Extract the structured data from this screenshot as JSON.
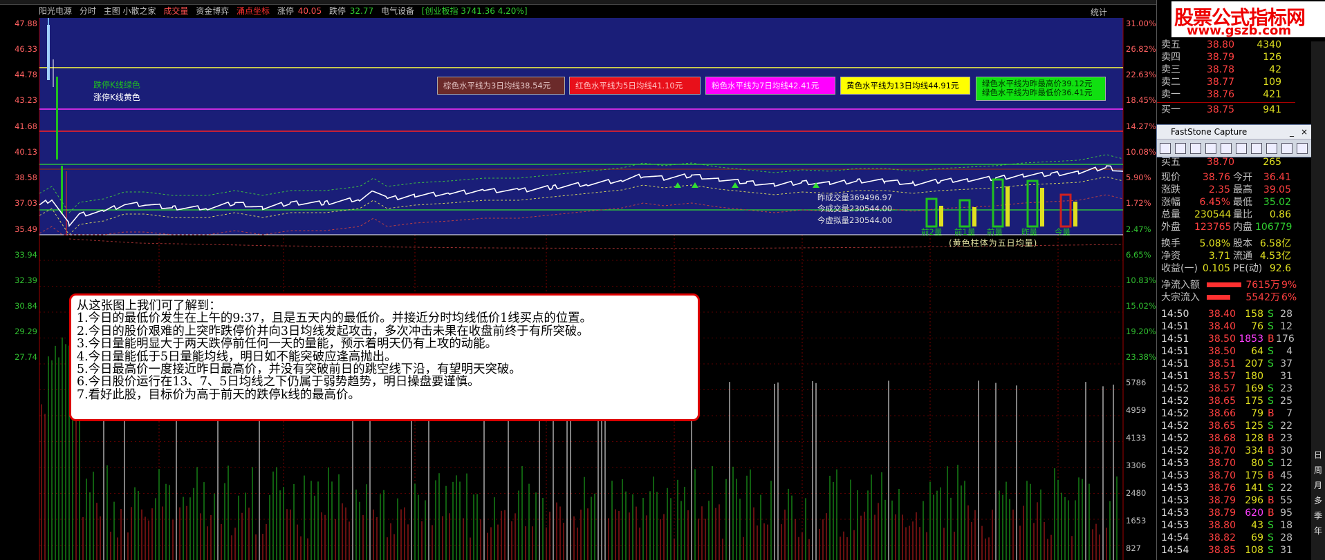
{
  "infobar": {
    "stock": "阳光电源",
    "tab_fen": "分时",
    "tab_main": "主图 小散之家",
    "deal": "成交量",
    "fund": "资金博弈",
    "hot": "涌点坐标",
    "up_label": "涨停",
    "up_value": "40.05",
    "down_label": "跌停",
    "down_value": "32.77",
    "sector": "电气设备",
    "index": "[创业板指 3741.36 4.20%]",
    "stats": "统计"
  },
  "price_labels": [
    "47.88",
    "46.33",
    "44.78",
    "43.23",
    "41.68",
    "40.13",
    "38.58",
    "37.03",
    "35.49",
    "33.94",
    "32.39",
    "30.84",
    "29.29",
    "27.74"
  ],
  "pct_labels": [
    "31.00%",
    "26.82%",
    "22.63%",
    "18.45%",
    "14.27%",
    "10.08%",
    "5.90%",
    "1.72%",
    "2.47%",
    "6.65%",
    "10.83%",
    "15.02%",
    "19.20%",
    "23.38%"
  ],
  "vol_labels": [
    "5786",
    "4959",
    "4133",
    "3306",
    "2480",
    "1653",
    "827"
  ],
  "overlay_labels": {
    "limit_down_green": "跌停K线绿色",
    "limit_up_yellow": "涨停K线黄色"
  },
  "legends": [
    {
      "text": "棕色水平线为3日均线38.54元",
      "bg": "#6b2a2a",
      "fg": "#e0c0c0"
    },
    {
      "text": "红色水平线为5日均线41.10元",
      "bg": "#e8101a",
      "fg": "#ffc0c0"
    },
    {
      "text": "粉色水平线为7日均线42.41元",
      "bg": "#ff00ff",
      "fg": "#ffe0ff"
    },
    {
      "text": "黄色水平线为13日均线44.91元",
      "bg": "#ffff00",
      "fg": "#000000"
    },
    {
      "text": "绿色水平线为昨最高价39.12元",
      "text2": "绿色水平线为昨最低价36.41元",
      "bg": "#10e010",
      "fg": "#003000"
    }
  ],
  "volume_info": {
    "yesterday": "昨成交量369496.97",
    "today": "今成交量230544.00",
    "virtual": "今虚拟量230544.00"
  },
  "bar_labels": [
    "前2量",
    "前1量",
    "前量",
    "昨量",
    "今量"
  ],
  "bar_note": "(黄色柱体为五日均量)",
  "note": {
    "lines": [
      "从这张图上我们可了解到：",
      "1.今日的最低价发生在上午的9:37，且是五天内的最低价。并接近分时均线低价1线买点的位置。",
      "2.今日的股价艰难的上突昨跌停价并向3日均线发起攻击，多次冲击未果在收盘前终于有所突破。",
      "3.今日量能明显大于两天跌停前任何一天的量能，预示着明天仍有上攻的动能。",
      "4.今日量能低于5日量能均线，明日如不能突破应逢高抛出。",
      "5.今日最高价一度接近昨日最高价，并没有突破前日的跳空线下沿，有望明天突破。",
      "6.今日股价运行在13、7、5日均线之下仍属于弱势趋势，明日操盘要谨慎。",
      "7.看好此股，目标价为高于前天的跌停k线的最高价。"
    ]
  },
  "watermark": {
    "cn": "股票公式指标网",
    "url": "www.gszb.com"
  },
  "order_book": [
    {
      "label": "卖五",
      "price": "38.80",
      "vol": "4340"
    },
    {
      "label": "卖四",
      "price": "38.79",
      "vol": "126"
    },
    {
      "label": "卖三",
      "price": "38.78",
      "vol": "42"
    },
    {
      "label": "卖二",
      "price": "38.77",
      "vol": "109"
    },
    {
      "label": "卖一",
      "price": "38.76",
      "vol": "421"
    },
    {
      "label": "买一",
      "price": "38.75",
      "vol": "941"
    },
    {
      "label": "买五",
      "price": "38.70",
      "vol": "265"
    }
  ],
  "faststone": {
    "title": "FastStone Capture",
    "min": "_",
    "close": "×"
  },
  "quote": [
    {
      "l1": "现价",
      "v1": "38.76",
      "l2": "今开",
      "v2": "36.41"
    },
    {
      "l1": "涨跌",
      "v1": "2.35",
      "l2": "最高",
      "v2": "39.05"
    },
    {
      "l1": "涨幅",
      "v1": "6.45%",
      "l2": "最低",
      "v2": "35.02"
    },
    {
      "l1": "总量",
      "v1": "230544",
      "l2": "量比",
      "v2": "0.86"
    },
    {
      "l1": "外盘",
      "v1": "123765",
      "l2": "内盘",
      "v2": "106779"
    },
    {
      "l1": "换手",
      "v1": "5.08%",
      "l2": "股本",
      "v2": "6.58亿"
    },
    {
      "l1": "净资",
      "v1": "3.71",
      "l2": "流通",
      "v2": "4.53亿"
    },
    {
      "l1": "收益(一)",
      "v1": "0.105",
      "l2": "PE(动)",
      "v2": "92.6"
    }
  ],
  "flow": [
    {
      "label": "净流入额",
      "value": "7615万",
      "pct": "9%"
    },
    {
      "label": "大宗流入",
      "value": "5542万",
      "pct": "6%"
    }
  ],
  "ticks": [
    {
      "t": "14:50",
      "p": "38.40",
      "v": "158",
      "s": "S",
      "n": "28"
    },
    {
      "t": "14:51",
      "p": "38.40",
      "v": "76",
      "s": "S",
      "n": "12"
    },
    {
      "t": "14:51",
      "p": "38.50",
      "v": "1853",
      "s": "B",
      "n": "176"
    },
    {
      "t": "14:51",
      "p": "38.50",
      "v": "64",
      "s": "S",
      "n": "4"
    },
    {
      "t": "14:51",
      "p": "38.51",
      "v": "207",
      "s": "S",
      "n": "37"
    },
    {
      "t": "14:51",
      "p": "38.57",
      "v": "180",
      "s": "",
      "n": "31"
    },
    {
      "t": "14:52",
      "p": "38.57",
      "v": "169",
      "s": "S",
      "n": "23"
    },
    {
      "t": "14:52",
      "p": "38.65",
      "v": "175",
      "s": "S",
      "n": "25"
    },
    {
      "t": "14:52",
      "p": "38.66",
      "v": "79",
      "s": "B",
      "n": "7"
    },
    {
      "t": "14:52",
      "p": "38.65",
      "v": "125",
      "s": "S",
      "n": "22"
    },
    {
      "t": "14:52",
      "p": "38.68",
      "v": "128",
      "s": "B",
      "n": "23"
    },
    {
      "t": "14:52",
      "p": "38.70",
      "v": "334",
      "s": "B",
      "n": "30"
    },
    {
      "t": "14:53",
      "p": "38.70",
      "v": "80",
      "s": "S",
      "n": "12"
    },
    {
      "t": "14:53",
      "p": "38.70",
      "v": "175",
      "s": "B",
      "n": "45"
    },
    {
      "t": "14:53",
      "p": "38.76",
      "v": "141",
      "s": "S",
      "n": "22"
    },
    {
      "t": "14:53",
      "p": "38.79",
      "v": "296",
      "s": "B",
      "n": "55"
    },
    {
      "t": "14:53",
      "p": "38.79",
      "v": "620",
      "s": "B",
      "n": "95"
    },
    {
      "t": "14:53",
      "p": "38.80",
      "v": "43",
      "s": "S",
      "n": "18"
    },
    {
      "t": "14:54",
      "p": "38.82",
      "v": "69",
      "s": "S",
      "n": "28"
    },
    {
      "t": "14:54",
      "p": "38.85",
      "v": "108",
      "s": "S",
      "n": "31"
    }
  ],
  "side_tabs": [
    "日",
    "周",
    "月",
    "多",
    "季",
    "年"
  ]
}
